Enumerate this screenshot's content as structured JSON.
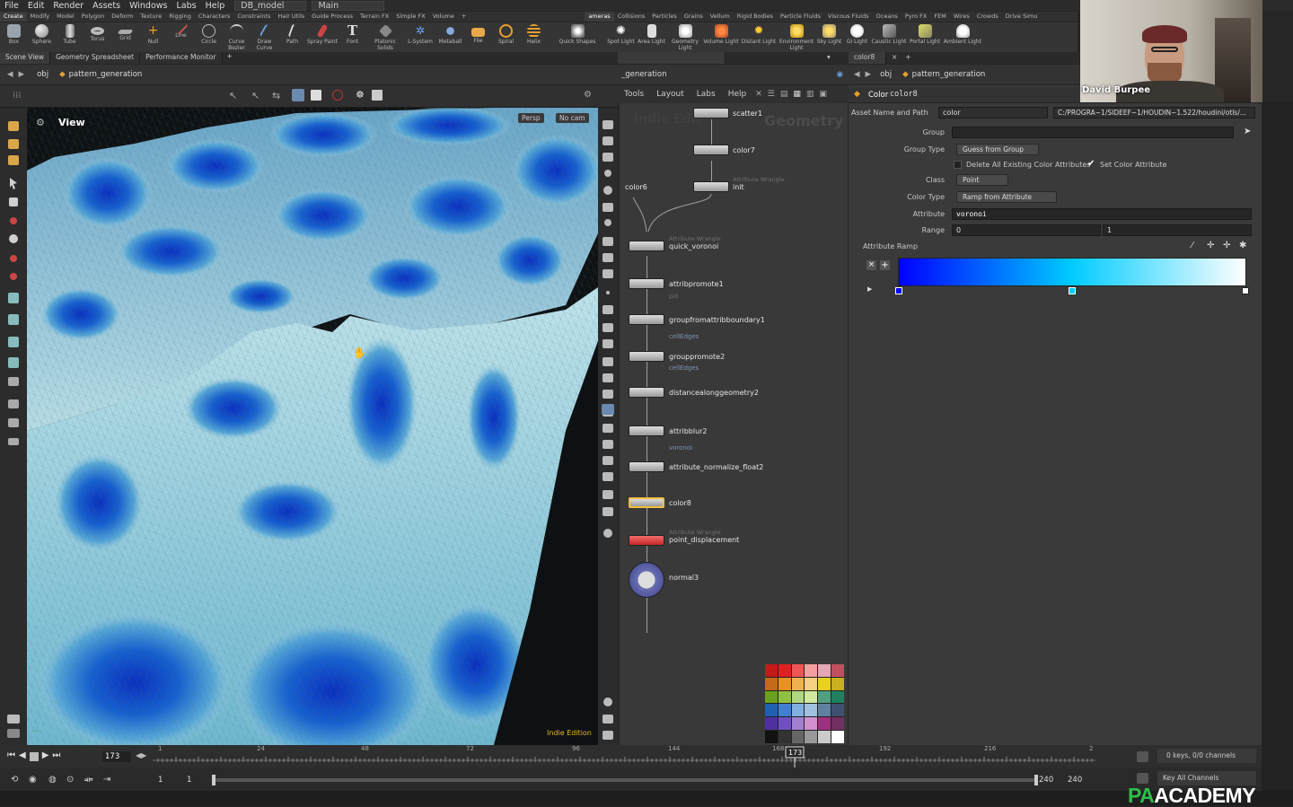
{
  "menubar": {
    "items": [
      "File",
      "Edit",
      "Render",
      "Assets",
      "Windows",
      "Labs",
      "Help"
    ],
    "desktop": "DB_model",
    "session": "Main"
  },
  "shelf": {
    "tabs": [
      "Create",
      "Modify",
      "Model",
      "Polygon",
      "Deform",
      "Texture",
      "Rigging",
      "Characters",
      "Constraints",
      "Hair Utils",
      "Guide Process",
      "Terrain FX",
      "Simple FX",
      "Volume",
      "+"
    ],
    "tools": [
      "Box",
      "Sphere",
      "Tube",
      "Torus",
      "Grid",
      "Null",
      "Line",
      "Circle",
      "Curve Bezier",
      "Draw Curve",
      "Path",
      "Spray Paint",
      "Font",
      "Platonic Solids",
      "L-System",
      "Metaball",
      "File",
      "Spiral",
      "Helix"
    ],
    "tabs2": [
      "ameras",
      "Collisions",
      "Particles",
      "Grains",
      "Vellum",
      "Rigid Bodies",
      "Particle Fluids",
      "Viscous Fluids",
      "Oceans",
      "Pyro FX",
      "FEM",
      "Wires",
      "Crowds",
      "Drive Simu"
    ],
    "tools2": [
      "Quick Shapes",
      "Spot Light",
      "Area Light",
      "Geometry Light",
      "Volume Light",
      "Distant Light",
      "Environment Light",
      "Sky Light",
      "GI Light",
      "Caustic Light",
      "Portal Light",
      "Ambient Light"
    ]
  },
  "left_pane": {
    "tabs": [
      "Scene View",
      "Geometry Spreadsheet",
      "Performance Monitor"
    ],
    "path_context": "obj",
    "path_node": "pattern_generation",
    "viewport_label": "View",
    "camera_persp": "Persp",
    "camera_nocam": "No cam",
    "edition": "Indie Edition"
  },
  "network": {
    "tab": "_generation",
    "menu": [
      "Tools",
      "Layout",
      "Labs",
      "Help"
    ],
    "watermark": "Geometry",
    "watermark2": "Indie Edit",
    "nodes": [
      {
        "name": "scatter1",
        "sub": "",
        "type": ""
      },
      {
        "name": "color7",
        "sub": "",
        "type": ""
      },
      {
        "name": "init",
        "sub": "",
        "type": "Attribute Wrangle"
      },
      {
        "name": "color6",
        "sub": "",
        "type": ""
      },
      {
        "name": "quick_voronoi",
        "sub": "",
        "type": "Attribute Wrangle"
      },
      {
        "name": "attribpromote1",
        "sub": "pid",
        "type": ""
      },
      {
        "name": "groupfromattribboundary1",
        "sub": "cellEdges",
        "type": ""
      },
      {
        "name": "grouppromote2",
        "sub": "cellEdges",
        "type": ""
      },
      {
        "name": "distancealonggeometry2",
        "sub": "",
        "type": ""
      },
      {
        "name": "attribblur2",
        "sub": "voronoi",
        "type": ""
      },
      {
        "name": "attribute_normalize_float2",
        "sub": "",
        "type": ""
      },
      {
        "name": "color8",
        "sub": "",
        "type": ""
      },
      {
        "name": "point_displacement",
        "sub": "",
        "type": "Attribute Wrangle"
      },
      {
        "name": "normal3",
        "sub": "",
        "type": ""
      }
    ]
  },
  "params": {
    "tab": "color8",
    "path_context": "obj",
    "path_node": "pattern_generation",
    "node_type": "Color",
    "node_name": "color8",
    "asset_label": "Asset Name and Path",
    "asset_name": "color",
    "asset_path": "C:/PROGRA~1/SIDEEF~1/HOUDIN~1.522/houdini/otls/...",
    "group_label": "Group",
    "group_value": "",
    "group_type_label": "Group Type",
    "group_type_value": "Guess from Group",
    "delete_attrs_label": "Delete All Existing Color Attributes",
    "set_color_label": "Set Color Attribute",
    "class_label": "Class",
    "class_value": "Point",
    "color_type_label": "Color Type",
    "color_type_value": "Ramp from Attribute",
    "attribute_label": "Attribute",
    "attribute_value": "voronoi",
    "range_label": "Range",
    "range_min": "0",
    "range_max": "1",
    "ramp_label": "Attribute Ramp",
    "ramp_colors": [
      "#0000ff",
      "#00ccff",
      "#ffffff"
    ]
  },
  "timeline": {
    "frame": "173",
    "ticks": [
      "1",
      "24",
      "48",
      "72",
      "96",
      "144",
      "168",
      "192",
      "216",
      "2"
    ],
    "start": "1",
    "start2": "1",
    "end": "240",
    "end2": "240",
    "keys": "0 keys, 0/0 channels",
    "key_all": "Key All Channels"
  },
  "webcam": {
    "name": "David Burpee"
  },
  "brand": {
    "pa": "PA",
    "academy": "ACADEMY"
  },
  "colors": {
    "accent": "#f0a020",
    "node_selected": "#f0c040",
    "node_display": "#e04040"
  }
}
